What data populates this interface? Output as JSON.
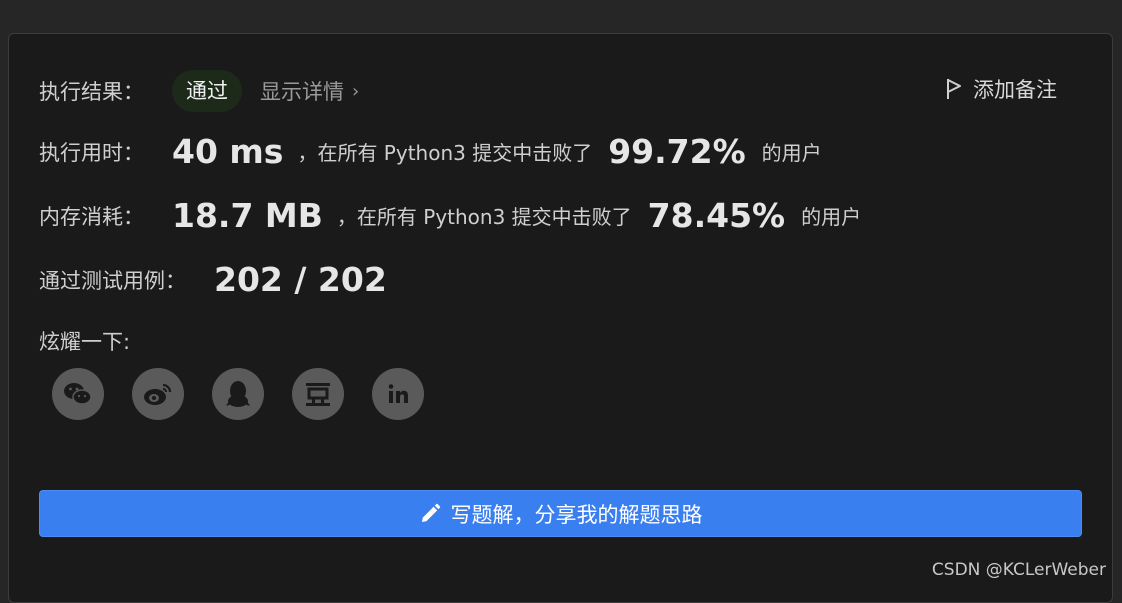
{
  "result": {
    "label": "执行结果：",
    "status": "通过",
    "details_link": "显示详情",
    "add_note": "添加备注"
  },
  "runtime": {
    "label": "执行用时：",
    "value": "40 ms",
    "text": "，在所有 Python3 提交中击败了",
    "percent": "99.72%",
    "suffix": "的用户"
  },
  "memory": {
    "label": "内存消耗：",
    "value": "18.7 MB",
    "text": "，在所有 Python3 提交中击败了",
    "percent": "78.45%",
    "suffix": "的用户"
  },
  "testcases": {
    "label": "通过测试用例：",
    "value": "202 / 202"
  },
  "share": {
    "label": "炫耀一下:",
    "icons": [
      "wechat-icon",
      "weibo-icon",
      "qq-icon",
      "douban-icon",
      "linkedin-icon"
    ]
  },
  "write_solution": {
    "label": "写题解，分享我的解题思路",
    "color": "#3a7ff0"
  },
  "watermark": "CSDN @KCLerWeber"
}
